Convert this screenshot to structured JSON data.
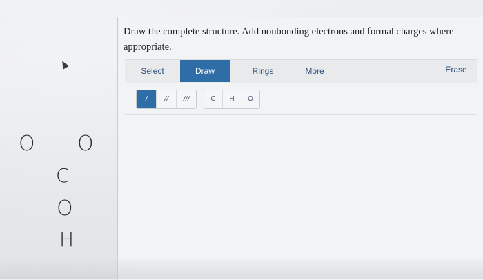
{
  "question": {
    "text": "Draw the complete structure. Add nonbonding electrons and formal charges where appropriate."
  },
  "toolbar": {
    "tabs": [
      {
        "label": "Select",
        "active": false
      },
      {
        "label": "Draw",
        "active": true
      },
      {
        "label": "Rings",
        "active": false
      },
      {
        "label": "More",
        "active": false
      },
      {
        "label": "Erase",
        "active": false
      }
    ]
  },
  "bond_tools": [
    {
      "label": "/",
      "icon": "single-bond-icon",
      "selected": true
    },
    {
      "label": "//",
      "icon": "double-bond-icon",
      "selected": false
    },
    {
      "label": "///",
      "icon": "triple-bond-icon",
      "selected": false
    }
  ],
  "atom_tools": [
    {
      "label": "C"
    },
    {
      "label": "H"
    },
    {
      "label": "O"
    }
  ],
  "handwritten_atoms": [
    "O",
    "O",
    "C",
    "O",
    "H"
  ],
  "colors": {
    "accent": "#2f6da7",
    "tab_text": "#2d4f7a",
    "panel_bg": "#f2f3f5"
  }
}
